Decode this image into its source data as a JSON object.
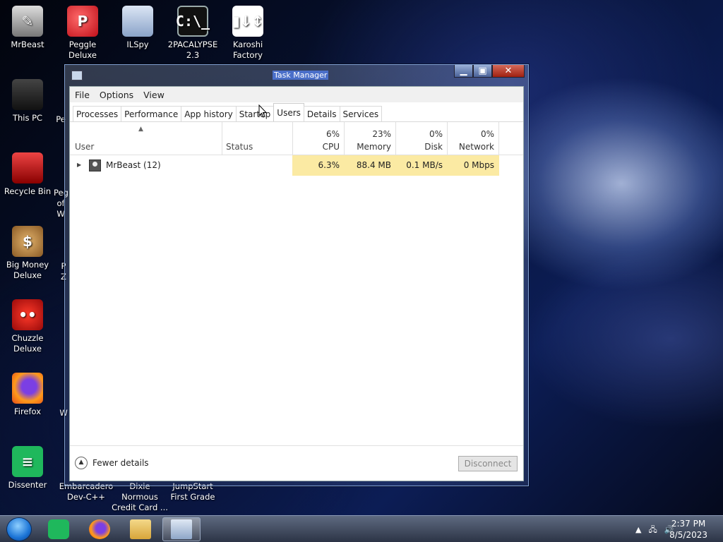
{
  "desktop": {
    "icons": [
      {
        "label": "MrBeast",
        "icon": "mrbeast-icon"
      },
      {
        "label": "Peggle Deluxe",
        "icon": "peggle-icon"
      },
      {
        "label": "ILSpy",
        "icon": "ilspy-icon"
      },
      {
        "label": "2PACALYPSE 2.3",
        "icon": "cmd-icon"
      },
      {
        "label": "Karoshi Factory",
        "icon": "karoshi-icon"
      },
      {
        "label": "This PC",
        "icon": "this-pc-icon"
      },
      {
        "label": "Recycle Bin",
        "icon": "recycle-bin-icon"
      },
      {
        "label": "Big Money Deluxe",
        "icon": "money-bag-icon"
      },
      {
        "label": "Chuzzle Deluxe",
        "icon": "chuzzle-icon"
      },
      {
        "label": "Firefox",
        "icon": "firefox-icon"
      },
      {
        "label": "Dissenter",
        "icon": "dissenter-icon"
      },
      {
        "label": "Embarcadero Dev-C++",
        "icon": "devcpp-icon"
      },
      {
        "label": "Dixie Normous Credit Card ...",
        "icon": "app-icon"
      },
      {
        "label": "JumpStart First Grade",
        "icon": "app-icon"
      }
    ],
    "partial_labels": {
      "pe": "Pe",
      "peg": "Peg",
      "of_w": "of W",
      "p": "P",
      "z": "Z",
      "w": "W"
    }
  },
  "window": {
    "title": "Task Manager",
    "caption": {
      "minimize": "▁",
      "maximize": "▣",
      "close": "✕"
    },
    "menu": [
      "File",
      "Options",
      "View"
    ],
    "tabs": [
      "Processes",
      "Performance",
      "App history",
      "Startup",
      "Users",
      "Details",
      "Services"
    ],
    "active_tab": "Users",
    "columns": {
      "user": "User",
      "status": "Status",
      "cpu": {
        "pct": "6%",
        "label": "CPU"
      },
      "memory": {
        "pct": "23%",
        "label": "Memory"
      },
      "disk": {
        "pct": "0%",
        "label": "Disk"
      },
      "network": {
        "pct": "0%",
        "label": "Network"
      }
    },
    "rows": [
      {
        "user": "MrBeast (12)",
        "status": "",
        "cpu": "6.3%",
        "memory": "88.4 MB",
        "disk": "0.1 MB/s",
        "network": "0 Mbps"
      }
    ],
    "footer": {
      "fewer_details": "Fewer details",
      "disconnect": "Disconnect"
    }
  },
  "taskbar": {
    "clock_time": "2:37 PM",
    "clock_date": "8/5/2023",
    "tray_up_arrow": "▲",
    "tray_network": "🖧",
    "tray_volume": "🔊"
  },
  "colors": {
    "heat": "#fbeaa3",
    "accent": "#4a6fc9"
  }
}
